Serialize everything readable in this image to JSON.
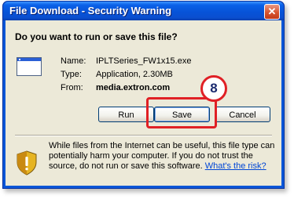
{
  "window": {
    "title": "File Download - Security Warning",
    "close_symbol": "✕"
  },
  "dialog": {
    "question": "Do you want to run or save this file?",
    "file": {
      "name_label": "Name:",
      "name_value": "IPLTSeries_FW1x15.exe",
      "type_label": "Type:",
      "type_value": "Application, 2.30MB",
      "from_label": "From:",
      "from_value": "media.extron.com"
    },
    "buttons": {
      "run": "Run",
      "save": "Save",
      "cancel": "Cancel"
    },
    "warning": {
      "text": "While files from the Internet can be useful, this file type can potentially harm your computer. If you do not trust the source, do not run or save this software. ",
      "link": "What's the risk?"
    }
  },
  "annotation": {
    "step_number": "8",
    "color": "#e02025"
  },
  "icons": {
    "program": "program-window-icon",
    "warning": "security-shield-icon"
  },
  "colors": {
    "titlebar": "#0a56d8",
    "dialog_bg": "#ece9d8",
    "link": "#0046d5"
  }
}
